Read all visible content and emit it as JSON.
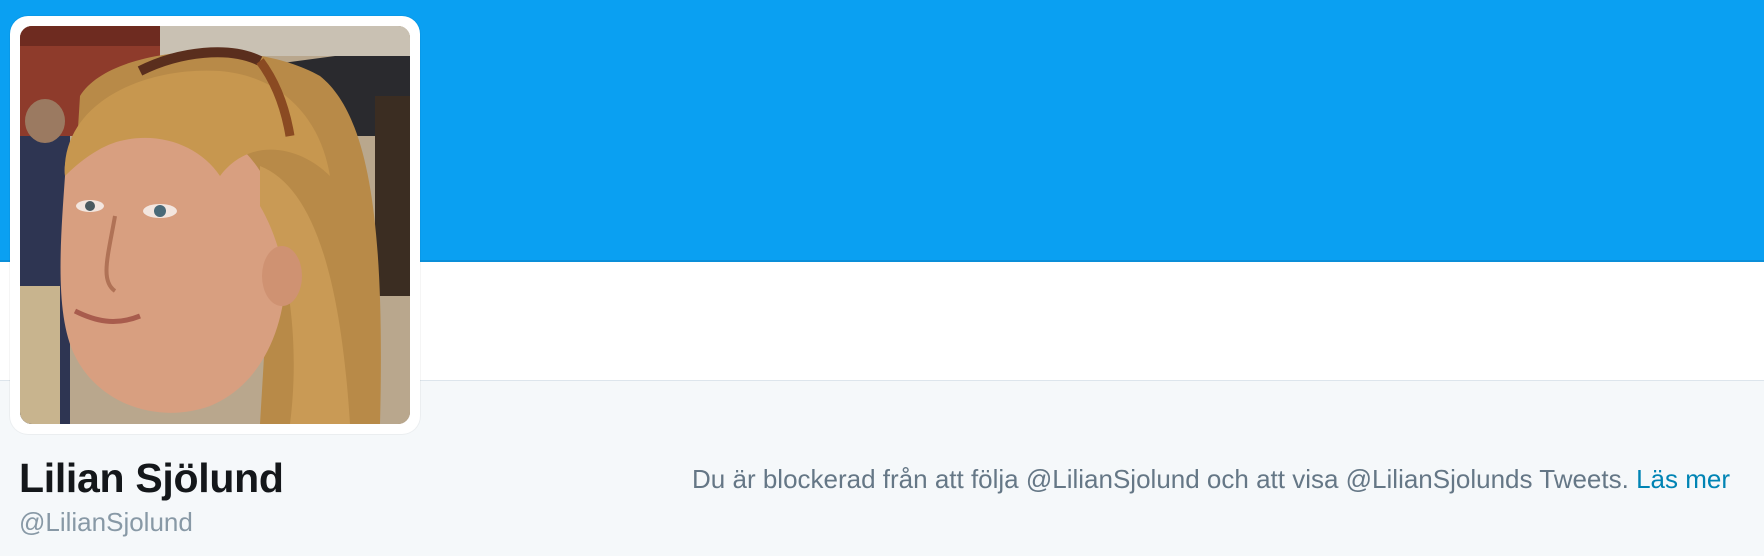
{
  "profile": {
    "display_name": "Lilian Sjölund",
    "handle": "@LilianSjolund",
    "avatar_alt": "Lilian Sjölund"
  },
  "notice": {
    "text": "Du är blockerad från att följa @LilianSjolund och att visa @LilianSjolunds Tweets.",
    "link_label": "Läs mer"
  },
  "colors": {
    "banner": "#0aa0f2",
    "link": "#0084b4",
    "background": "#f5f8fa"
  }
}
